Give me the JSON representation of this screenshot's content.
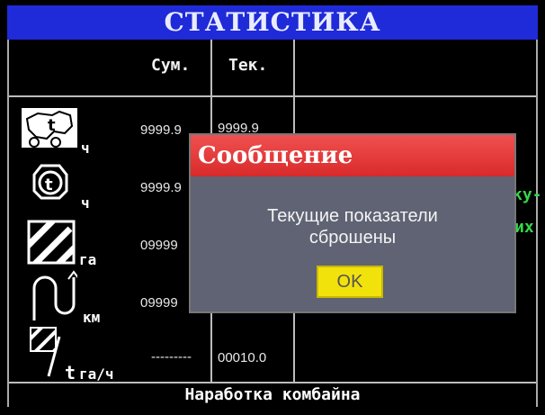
{
  "header": {
    "title": "СТАТИСТИКА"
  },
  "table": {
    "columns": [
      "Сум.",
      "Тек."
    ],
    "rows": [
      {
        "icon": "tractor-hours-icon",
        "unit": "ч",
        "sum": "9999.9",
        "cur": "9999.9"
      },
      {
        "icon": "engine-hours-icon",
        "unit": "ч",
        "sum": "9999.9",
        "cur": ""
      },
      {
        "icon": "area-icon",
        "unit": "га",
        "sum": "09999",
        "cur": ""
      },
      {
        "icon": "distance-icon",
        "unit": "км",
        "sum": "09999",
        "cur": ""
      },
      {
        "icon": "productivity-icon",
        "unit": "га/ч",
        "prefix": "t",
        "sum": "---------",
        "cur": "00010.0"
      }
    ]
  },
  "side_partial": [
    "ку-",
    "их"
  ],
  "footer": {
    "text": "Наработка комбайна"
  },
  "dialog": {
    "title": "Сообщение",
    "message_line1": "Текущие показатели",
    "message_line2": "сброшены",
    "ok_label": "OK"
  },
  "colors": {
    "title_bg": "#1f2ad8",
    "dialog_title": "#e23a3a",
    "dialog_bg": "#5f6373",
    "ok_bg": "#f2e20c",
    "side_text": "#34d64a"
  }
}
